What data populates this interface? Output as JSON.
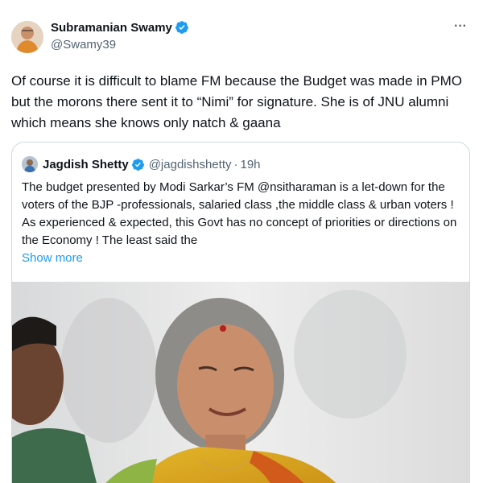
{
  "author": {
    "display_name": "Subramanian Swamy",
    "handle": "@Swamy39",
    "verified_icon": "verified-badge-icon"
  },
  "tweet": {
    "text": "Of course it is difficult to blame FM because the Budget was made in PMO but the morons there sent it to “Nimi” for signature. She is of JNU alumni which means she knows only natch & gaana"
  },
  "quoted": {
    "display_name": "Jagdish Shetty",
    "handle": "@jagdishshetty",
    "separator": "·",
    "time": "19h",
    "text": "The budget presented by Modi Sarkar’s FM @nsitharaman is a let-down for the voters of the BJP -professionals, salaried class ,the middle class & urban voters ! As experienced & expected, this Govt has no concept of priorities or directions on the Economy ! The least said the",
    "show_more": "Show more"
  },
  "colors": {
    "text": "#0f1419",
    "secondary": "#536471",
    "link": "#1d9bf0",
    "border": "#cfd9de"
  }
}
